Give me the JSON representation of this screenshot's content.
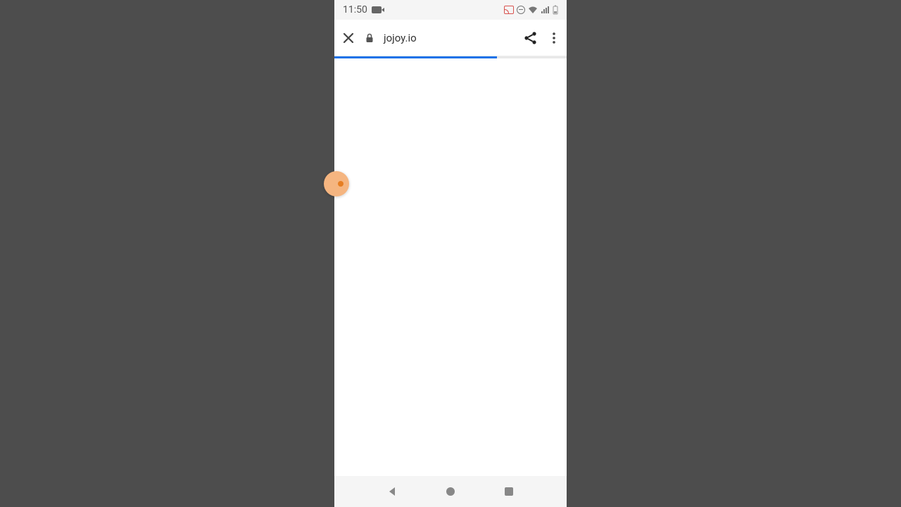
{
  "status": {
    "time": "11:50"
  },
  "browser": {
    "url": "jojoy.io",
    "progress_percent": 70
  }
}
